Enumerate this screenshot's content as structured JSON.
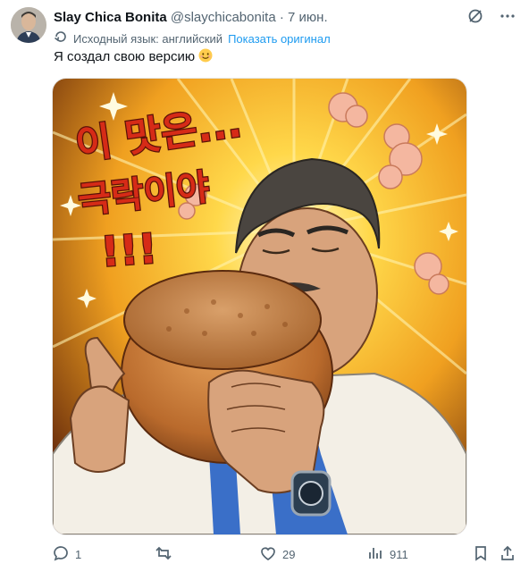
{
  "tweet": {
    "display_name": "Slay Chica Bonita",
    "handle": "@slaychicabonita",
    "separator": "·",
    "date": "7 июн.",
    "translation_note": "Исходный язык: английский",
    "show_original": "Показать оригинал",
    "text": "Я создал свою версию",
    "emoji": "☺"
  },
  "media": {
    "caption_line1": "이 맛은...",
    "caption_line2": "극락이야",
    "caption_line3": "!!!"
  },
  "actions": {
    "replies": "1",
    "retweets": "",
    "likes": "29",
    "views": "911"
  },
  "colors": {
    "link": "#1d9bf0",
    "muted": "#536471",
    "caption_red": "#d62b17"
  },
  "icons": [
    "grok-icon",
    "more-icon",
    "translate-icon",
    "reply-icon",
    "retweet-icon",
    "like-icon",
    "views-icon",
    "bookmark-icon",
    "share-icon"
  ]
}
